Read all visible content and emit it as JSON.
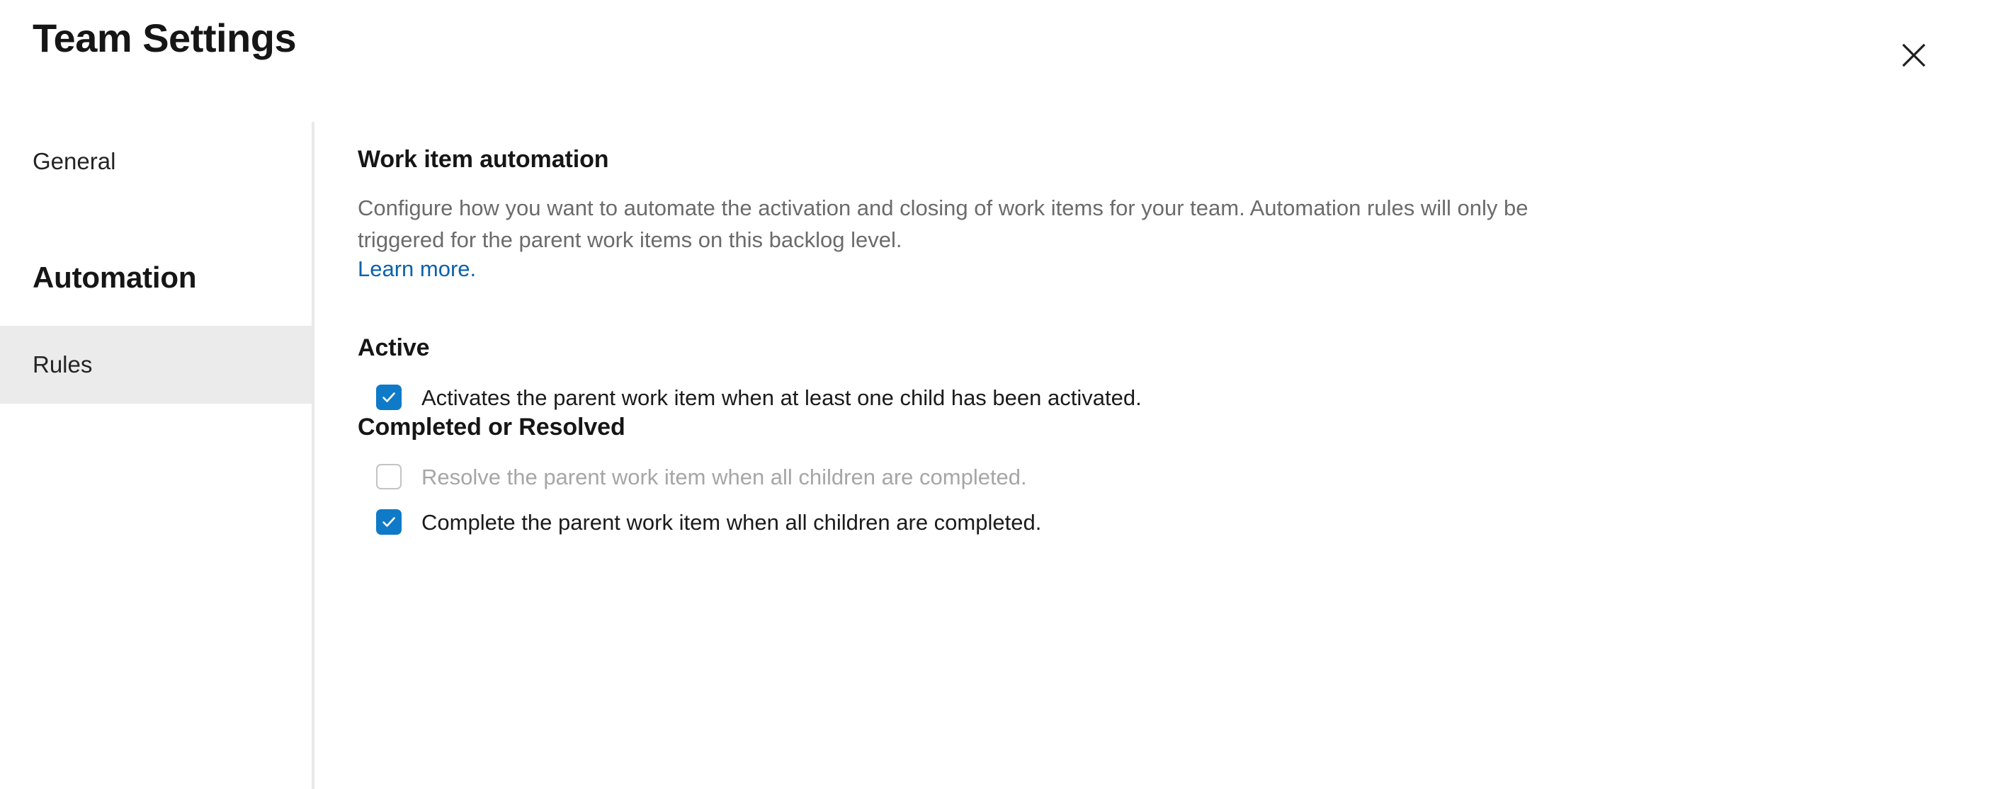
{
  "header": {
    "title": "Team Settings",
    "close_label": "Close",
    "close_icon": "close-icon"
  },
  "sidebar": {
    "items": [
      {
        "label": "General",
        "selected": false
      },
      {
        "label": "Rules",
        "selected": true
      }
    ],
    "group_title": "Automation"
  },
  "main": {
    "section_title": "Work item automation",
    "description_line1": "Configure how you want to automate the activation and closing of work items for your team. Automation rules will only be",
    "description_line2": "triggered for the parent work items on this backlog level.",
    "learn_more": "Learn more.",
    "groups": [
      {
        "heading": "Active",
        "options": [
          {
            "label": "Activates the parent work item when at least one child has been activated.",
            "checked": true,
            "disabled": false
          }
        ]
      },
      {
        "heading": "Completed or Resolved",
        "options": [
          {
            "label": "Resolve the parent work item when all children are completed.",
            "checked": false,
            "disabled": true
          },
          {
            "label": "Complete the parent work item when all children are completed.",
            "checked": true,
            "disabled": false
          }
        ]
      }
    ]
  },
  "colors": {
    "accent_blue": "#0f7ac8",
    "link_blue": "#0a62ac",
    "selected_nav_bg": "#ebebeb",
    "divider": "#e9e9e9",
    "muted_text": "#6b6b6b",
    "disabled_text": "#a6a6a6"
  }
}
